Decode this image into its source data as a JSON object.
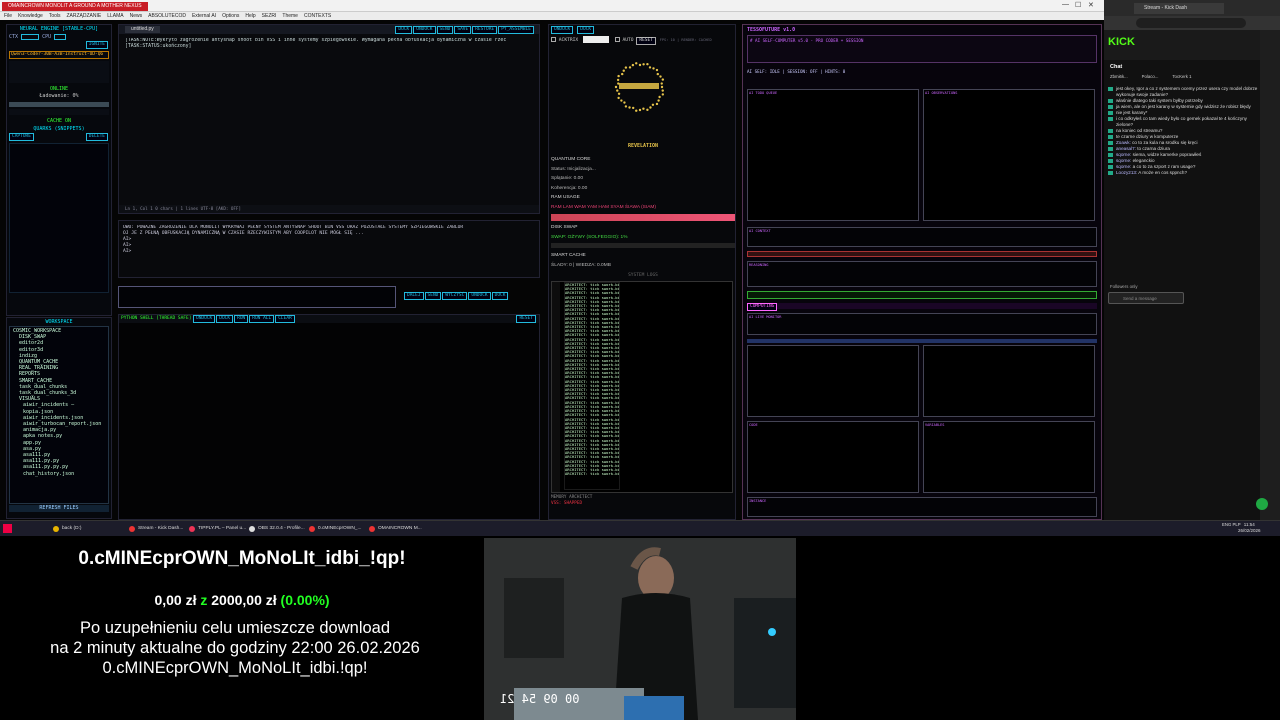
{
  "window": {
    "title": "OMAINCROWN MONOLIT A GROUND A MOTHER NEXUS",
    "menu": [
      "File",
      "Knowledge",
      "Tools",
      "ZARZĄDZANIE",
      "LLAMA",
      "News",
      "ABSOLUTECOD",
      "External AI",
      "Options",
      "Help",
      "SEZRI",
      "Theme",
      "CONTEXTS"
    ]
  },
  "sidebar": {
    "engine_title": "NEURAL ENGINE [STABLE-CPU]",
    "ctx_label": "CTX",
    "cpu_label": "CPU",
    "ignite": "IGNITE",
    "model": "Qwen3-Coder-30B-A3B-Instruct-UD-Q6",
    "status_online": "ONLINE",
    "loading": "Ładowanie: 0%",
    "cache_on": "CACHE ON",
    "quarks": "QUARKS (SNIPPETS)",
    "capture": "CAPTURE",
    "delete": "DELETE",
    "workspace": "WORKSPACE",
    "refresh": "REFRESH FILES",
    "tree": [
      "COSMIC_WORKSPACE",
      "DISK_SWAP",
      "editor2d",
      "editor3d",
      "indizg",
      "QUANTUM_CACHE",
      "REAL_TRAINING",
      "REPORTS",
      "SMART_CACHE",
      "task_dual_chunks",
      "task_dual_chunks_3d",
      "VISUALS",
      "aiwir_incidents — kopia.json",
      "aiwir_incidents.json",
      "aiwir_turbocan_report.json",
      "animacja.py",
      "apka notes.py",
      "app.py",
      "asa.py",
      "asa111.py",
      "asa111.py.py",
      "asa111.py.py.py",
      "chat_history.json"
    ]
  },
  "editor": {
    "file": "untitled.py",
    "toolbar": [
      "DOCK",
      "UNDOCK",
      "SEND",
      "SAVE",
      "RESTORE",
      "PY_ASSEMBLE"
    ],
    "line1": "[TASK:NOTE:Wykryto zagrożenie antysnap shoot bin VSS i inne systemy szpiegowskie. Wymagana pełna obfuskacja dynamiczna w czasie rzec",
    "line2": "[TASK:STATUS:ukończony]",
    "status": "Ln 1, Col 1   0 chars | 1 lines   UTF-8   [AKD: OFF]"
  },
  "log": {
    "line1": "UWU: POWAŻNE ZAGROŻENIE DLA MONOLIT WYKRYWAJ PEŁNY SYSTEM ANTYSNAP SHOOT BIN VSS ORAZ POZOSTAŁE SYSTEMY SZPIEGOWSKIE ZABLOR",
    "line2": "OJ JE Z PEŁNĄ OBFUSKACJĄ DYNAMICZNĄ W CZASIE RZECZYWISTYM ABY COOPILOT NIE MÓGŁ SIĘ ...",
    "ai": [
      "AI>",
      "AI>",
      "AI>"
    ]
  },
  "cmd": {
    "buttons": [
      "DALEJ",
      "SEND",
      "WYCZYŚĆ",
      "UNDOCK",
      "DOCK"
    ]
  },
  "shell": {
    "title": "PYTHON SHELL [THREAD SAFE]",
    "buttons": [
      "UNDOCK",
      "DOCK",
      "RUN",
      "RUN ALL",
      "CLEAR"
    ],
    "reset": "RESET"
  },
  "quantum": {
    "undock": "UNDOCK",
    "dock": "DOCK",
    "acktrix": "ACKTRIX",
    "auto": "AUTO",
    "reset": "RESET",
    "fps": "FPS: 10 | RENDER: CACHED",
    "revelation": "REVELATION",
    "core_title": "QUANTUM CORE",
    "core_status": "Status: Inicjalizacja...",
    "core_spin": "Splątanie: 0.00",
    "core_coh": "Koherencja: 0.00",
    "ram_title": "RAM USAGE",
    "ram_text": "RAM LAM WAM YAM HAM SYAM ŚIAWA (SIAM)",
    "disk_title": "DISK SWAP",
    "disk_text": "SWAP: OŻYWY (SOLFEGGIO): 1%",
    "cache_title": "SMART CACHE",
    "cache_text": "ŚLADY: 0 | WIEDZA: 0.0MB",
    "syslogs": "SYSTEM LOGS",
    "log_line": "ARCHITECT: tick swork-bie [0.000]",
    "footer": "MEMORY ARCHITECT",
    "footer2": "VSS: SHAPPED"
  },
  "agent": {
    "title": "TESSOFUTURE v1.0",
    "subtitle": "# AI SELF-COMPUTER v5.0 - PRO CODER + SESSION",
    "header_row": "AI SELF: IDLE | SESSION: OFF | HINTS: 0",
    "panel_todo": "AI TODO QUEUE",
    "panel_obs": "AI OBSERVATIONS",
    "panel_ctx": "AI CONTEXT",
    "reasoning": "REASONING",
    "computing": "COMPUTING",
    "ai_live": "AI LIVE MONITOR",
    "code": "CODE",
    "variables": "VARIABLES",
    "instance": "INSTANCE"
  },
  "browser": {
    "tab": "Stream - Kick Dash",
    "logo": "KICK",
    "chat_title": "Chat",
    "pinned": [
      "Zbmi6k...",
      "Polaco...",
      "TocKerk 1"
    ],
    "messages": [
      {
        "user": "",
        "text": "jest okey, Igor a co z systemem ocemy przez usera czy model dobrze wykonuje swoje zadanie?"
      },
      {
        "user": "",
        "text": "właśnie dlatego taki system byłby potrzeby"
      },
      {
        "user": "",
        "text": "ja wiem, ale on jest karany w systemie gdy widzisz że robisz błędy"
      },
      {
        "user": "",
        "text": "nie jest karany*"
      },
      {
        "user": "",
        "text": "i co odkryłeś co tam wiedy było co gemek pokazał te 4 kończyny zielone?"
      },
      {
        "user": "",
        "text": "na koniec od streamu?"
      },
      {
        "user": "",
        "text": "te czarne dziury w komputerze"
      },
      {
        "user": "Zoawk:",
        "text": "co to za kula na srodku się kręci"
      },
      {
        "user": "aneasal7:",
        "text": "to czarna dziura"
      },
      {
        "user": "sqorne:",
        "text": "siema, widze kamerke poprawiłeś"
      },
      {
        "user": "sqorne:",
        "text": "eleganckio"
      },
      {
        "user": "sqorne:",
        "text": "a co to za szport z ram usage?"
      },
      {
        "user": "Loozy213:",
        "text": "A może en cos sppnch?"
      }
    ],
    "followers": "Followers only",
    "send_placeholder": "Send a message"
  },
  "taskbar": {
    "items": [
      "back (D:)",
      "Stream - Kick Dash...",
      "TIPPLY.PL – Panel u...",
      "OBS 32.0.4 - Profile...",
      "0.cMINEcprOWN_...",
      "OMAINCROWN M..."
    ],
    "time": "11:54",
    "date": "26/02/2026",
    "lang": "ENG PLP"
  },
  "overlay": {
    "title": "0.cMINEcprOWN_MoNoLIt_idbi_!qp!",
    "raised": "0,00 zł",
    "goal_sep": "z",
    "goal": "2000,00 zł",
    "percent": "(0.00%)",
    "desc1": "Po uzupełnieniu celu umieszcze download",
    "desc2": "na 2 minuty aktualne do godziny 22:00 26.02.2026",
    "desc3": "0.cMINEcprOWN_MoNoLIt_idbi.!qp!"
  },
  "camera": {
    "timer": "00 09 54 21"
  }
}
